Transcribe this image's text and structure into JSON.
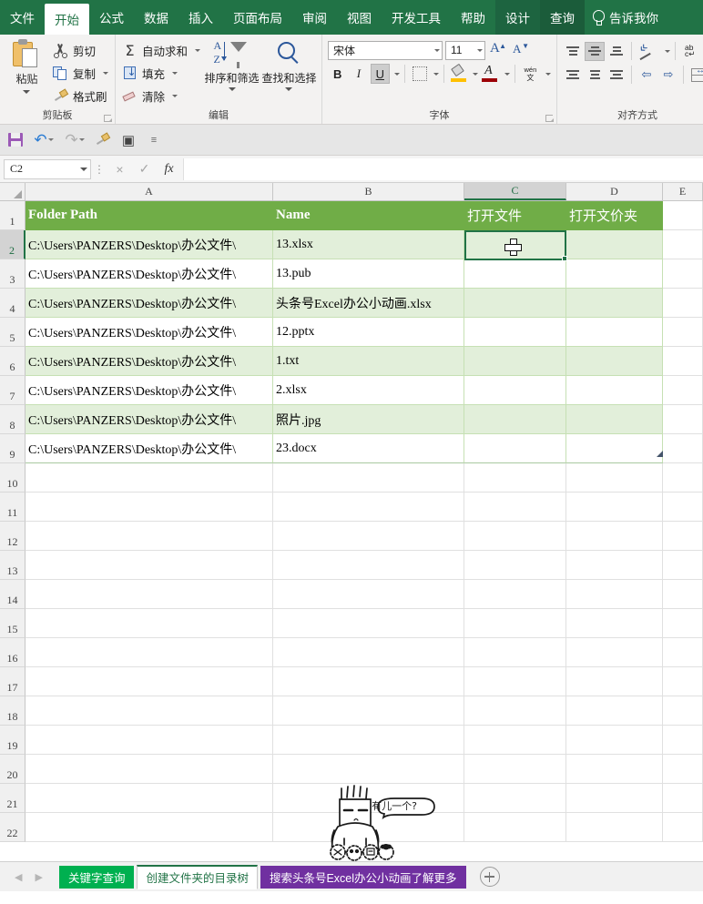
{
  "ribbon": {
    "tabs": [
      {
        "label": "文件",
        "state": "normal"
      },
      {
        "label": "开始",
        "state": "active"
      },
      {
        "label": "公式",
        "state": "normal"
      },
      {
        "label": "数据",
        "state": "normal"
      },
      {
        "label": "插入",
        "state": "normal"
      },
      {
        "label": "页面布局",
        "state": "normal"
      },
      {
        "label": "审阅",
        "state": "normal"
      },
      {
        "label": "视图",
        "state": "normal"
      },
      {
        "label": "开发工具",
        "state": "normal"
      },
      {
        "label": "帮助",
        "state": "normal"
      },
      {
        "label": "设计",
        "state": "contextual"
      },
      {
        "label": "查询",
        "state": "contextual2"
      }
    ],
    "tell_me": "告诉我你",
    "groups": {
      "clipboard": {
        "label": "剪贴板",
        "paste": "粘贴",
        "cut": "剪切",
        "copy": "复制",
        "format_painter": "格式刷"
      },
      "editing": {
        "label": "编辑",
        "autosum": "自动求和",
        "fill": "填充",
        "clear": "清除",
        "sort_filter": "排序和筛选",
        "find_select": "查找和选择"
      },
      "font": {
        "label": "字体",
        "font_name": "宋体",
        "font_size": "11",
        "bold": "B",
        "italic": "I",
        "underline": "U",
        "phonetic": "wén 文"
      },
      "alignment": {
        "label": "对齐方式"
      }
    }
  },
  "quick_access": {
    "save": "save-icon",
    "undo": "undo-icon",
    "redo": "redo-icon",
    "format_painter": "format-painter-icon",
    "print_preview": "print-preview-icon",
    "more": "more-commands"
  },
  "formula_bar": {
    "name_box": "C2",
    "cancel": "×",
    "enter": "✓",
    "fx": "fx",
    "value": ""
  },
  "grid": {
    "columns": [
      {
        "letter": "A",
        "selected": false
      },
      {
        "letter": "B",
        "selected": false
      },
      {
        "letter": "C",
        "selected": true
      },
      {
        "letter": "D",
        "selected": false
      },
      {
        "letter": "E",
        "selected": false
      }
    ],
    "rows": [
      "1",
      "2",
      "3",
      "4",
      "5",
      "6",
      "7",
      "8",
      "9",
      "10",
      "11",
      "12",
      "13",
      "14",
      "15",
      "16",
      "17",
      "18",
      "19",
      "20",
      "21",
      "22"
    ],
    "selected_cell": "C2",
    "table": {
      "headers": [
        "Folder Path",
        "Name",
        "打开文件",
        "打开文价夹"
      ],
      "data": [
        {
          "row": "2",
          "a": "C:\\Users\\PANZERS\\Desktop\\办公文件\\",
          "b": "13.xlsx",
          "c": "",
          "d": ""
        },
        {
          "row": "3",
          "a": "C:\\Users\\PANZERS\\Desktop\\办公文件\\",
          "b": "13.pub",
          "c": "",
          "d": ""
        },
        {
          "row": "4",
          "a": "C:\\Users\\PANZERS\\Desktop\\办公文件\\",
          "b": "头条号Excel办公小动画.xlsx",
          "c": "",
          "d": ""
        },
        {
          "row": "5",
          "a": "C:\\Users\\PANZERS\\Desktop\\办公文件\\",
          "b": "12.pptx",
          "c": "",
          "d": ""
        },
        {
          "row": "6",
          "a": "C:\\Users\\PANZERS\\Desktop\\办公文件\\",
          "b": "1.txt",
          "c": "",
          "d": ""
        },
        {
          "row": "7",
          "a": "C:\\Users\\PANZERS\\Desktop\\办公文件\\",
          "b": "2.xlsx",
          "c": "",
          "d": ""
        },
        {
          "row": "8",
          "a": "C:\\Users\\PANZERS\\Desktop\\办公文件\\",
          "b": "照片.jpg",
          "c": "",
          "d": ""
        },
        {
          "row": "9",
          "a": "C:\\Users\\PANZERS\\Desktop\\办公文件\\",
          "b": "23.docx",
          "c": "",
          "d": ""
        }
      ]
    },
    "doodle": {
      "speech": "有儿一个?"
    }
  },
  "sheet_tabs": [
    {
      "label": "关键字查询",
      "style": "green"
    },
    {
      "label": "创建文件夹的目录树",
      "style": "active"
    },
    {
      "label": "搜索头条号Excel办公小动画了解更多",
      "style": "purple"
    }
  ],
  "colors": {
    "excel_green": "#217346",
    "table_header": "#70ad47",
    "band": "#e2efda",
    "tab_green": "#00b050",
    "tab_purple": "#7030a0"
  }
}
